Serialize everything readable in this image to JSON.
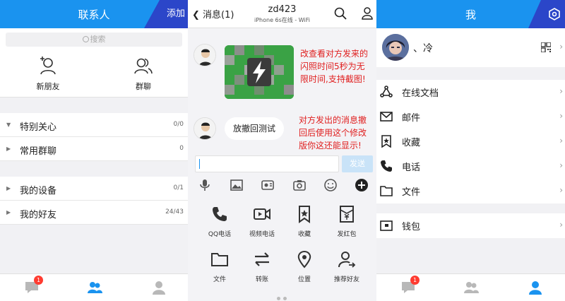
{
  "left": {
    "header_title": "联系人",
    "add_label": "添加",
    "search_placeholder": "搜索",
    "actions": [
      {
        "label": "新朋友"
      },
      {
        "label": "群聊"
      }
    ],
    "groups": [
      [
        {
          "name": "特别关心",
          "count": "0/0",
          "expanded": true
        },
        {
          "name": "常用群聊",
          "count": "0",
          "expanded": false
        }
      ],
      [
        {
          "name": "我的设备",
          "count": "0/1",
          "expanded": false
        },
        {
          "name": "我的好友",
          "count": "24/43",
          "expanded": false
        }
      ]
    ],
    "tab_badge": "1"
  },
  "chat": {
    "back_label": "消息(1)",
    "title": "zd423",
    "subtitle": "iPhone 6s在线 - WiFi",
    "message_text": "放撤回测试",
    "annotation_1": [
      "改查看对方发来的",
      "闪照时间5秒为无",
      "限时间,支持截图!"
    ],
    "annotation_2": [
      "对方发出的消息撤",
      "回后使用这个修改",
      "版你这还能显示!"
    ],
    "send_label": "发送",
    "grid": [
      {
        "label": "QQ电话",
        "icon": "phone-icon"
      },
      {
        "label": "视频电话",
        "icon": "video-call-icon"
      },
      {
        "label": "收藏",
        "icon": "favorite-icon"
      },
      {
        "label": "发红包",
        "icon": "red-packet-icon"
      },
      {
        "label": "文件",
        "icon": "folder-icon"
      },
      {
        "label": "转账",
        "icon": "transfer-icon"
      },
      {
        "label": "位置",
        "icon": "location-icon"
      },
      {
        "label": "推荐好友",
        "icon": "recommend-friend-icon"
      }
    ]
  },
  "me": {
    "header_title": "我",
    "username": "、冷",
    "items": [
      {
        "label": "在线文档",
        "icon": "online-doc-icon"
      },
      {
        "label": "邮件",
        "icon": "mail-icon"
      },
      {
        "label": "收藏",
        "icon": "favorite-icon"
      },
      {
        "label": "电话",
        "icon": "phone-icon"
      },
      {
        "label": "文件",
        "icon": "folder-icon"
      }
    ],
    "wallet_label": "钱包"
  },
  "colors": {
    "accent_blue": "#1a93ef",
    "dark_blue": "#2b46c9",
    "annotation_red": "#e02020",
    "badge_red": "#ff3b30"
  }
}
